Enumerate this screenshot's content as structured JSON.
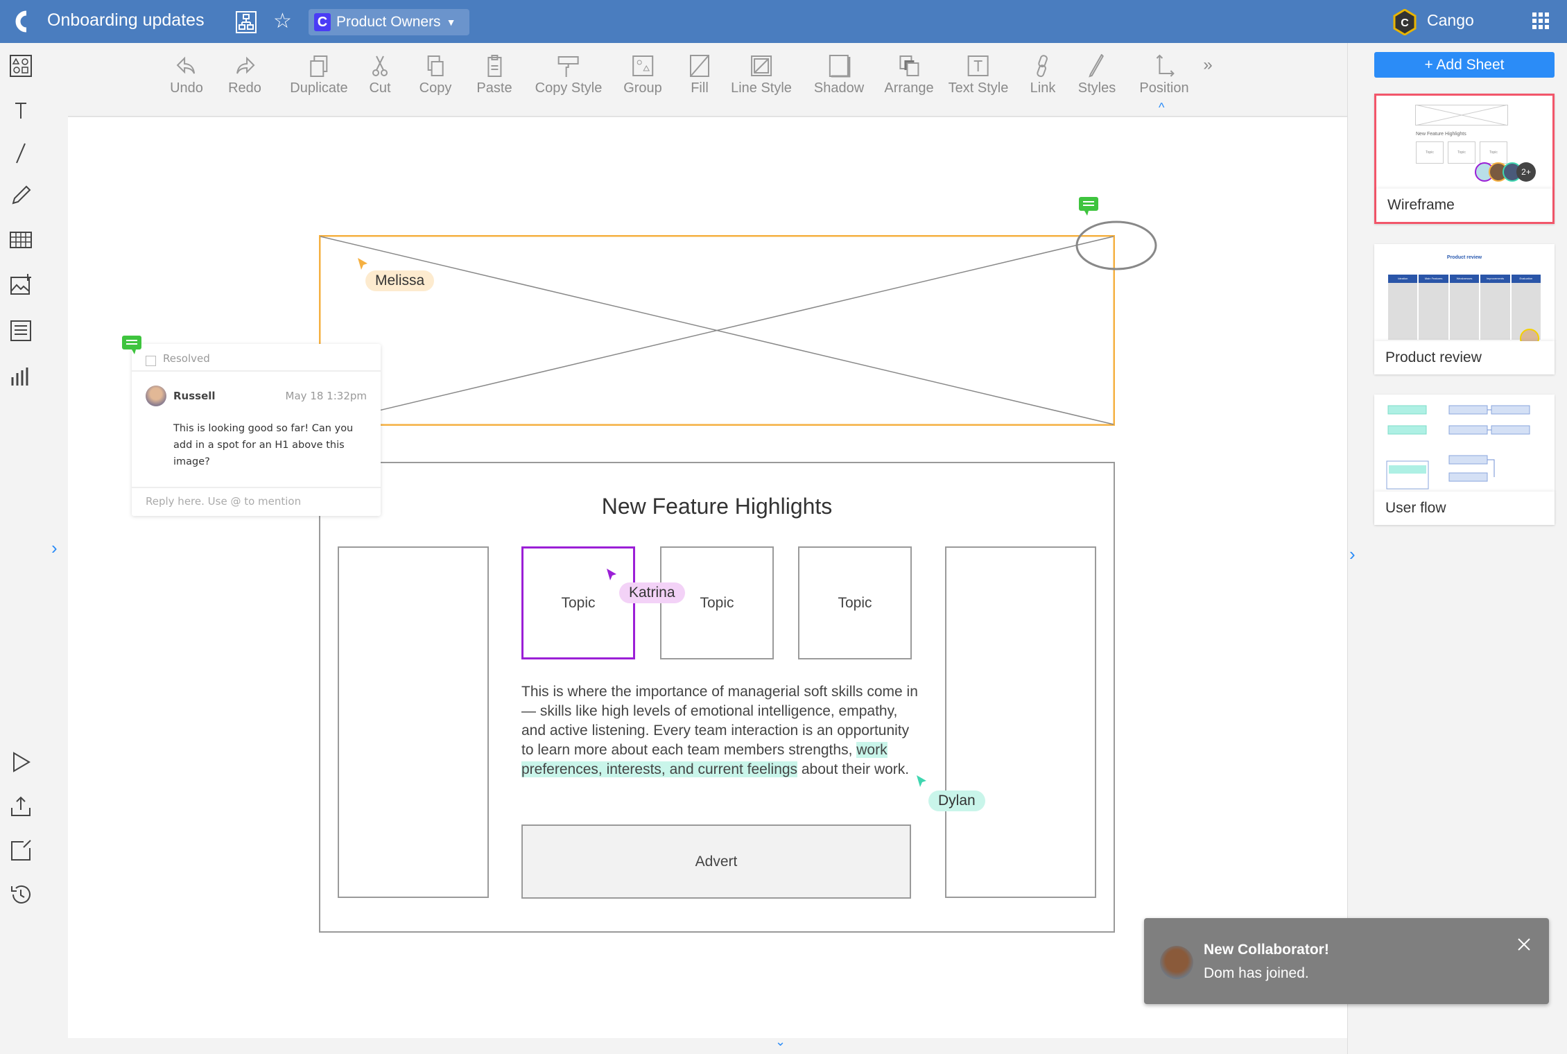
{
  "header": {
    "title": "Onboarding updates",
    "team_label": "Product Owners",
    "brand": "Cango"
  },
  "toolbar": {
    "items": [
      "Undo",
      "Redo",
      "Duplicate",
      "Cut",
      "Copy",
      "Paste",
      "Copy Style",
      "Group",
      "Fill",
      "Line Style",
      "Shadow",
      "Arrange",
      "Text Style",
      "Link",
      "Styles",
      "Position"
    ],
    "more": "»"
  },
  "sidebar": {
    "add_sheet": "+ Add Sheet",
    "sheets": [
      {
        "label": "Wireframe",
        "active": true,
        "preview_title": "New Feature Highlights",
        "preview_topics": [
          "Topic",
          "Topic",
          "Topic"
        ],
        "avatar_more": "2+"
      },
      {
        "label": "Product review",
        "preview_title": "Product review",
        "preview_columns": [
          "Ideation",
          "Main Features",
          "Weaknesses",
          "Improvements",
          "Evaluation"
        ]
      },
      {
        "label": "User flow"
      }
    ]
  },
  "canvas": {
    "heading": "New Feature Highlights",
    "topics": [
      "Topic",
      "Topic",
      "Topic"
    ],
    "paragraph_before": "This is where the importance of managerial soft skills come in — skills like high levels of emotional intelligence, empathy, and active listening. Every team interaction is an opportunity to learn more about each team members strengths, ",
    "paragraph_highlight": "work preferences, interests, and current feelings",
    "paragraph_after": " about their work.",
    "advert": "Advert",
    "cursors": [
      {
        "name": "Melissa",
        "color": "#f5b041"
      },
      {
        "name": "Katrina",
        "color": "#9b1fd6"
      },
      {
        "name": "Dylan",
        "color": "#3fd6b0"
      }
    ]
  },
  "comment": {
    "resolved_label": "Resolved",
    "author": "Russell",
    "time": "May 18 1:32pm",
    "text": "This is looking good so far! Can you add in a spot for an H1 above this image?",
    "reply_placeholder": "Reply here. Use @ to mention"
  },
  "toast": {
    "title": "New Collaborator!",
    "message": "Dom has joined."
  },
  "colors": {
    "header": "#4a7dbf",
    "accent": "#2b8cf7",
    "selection": "#f5b041",
    "active_sheet": "#f2566a"
  }
}
